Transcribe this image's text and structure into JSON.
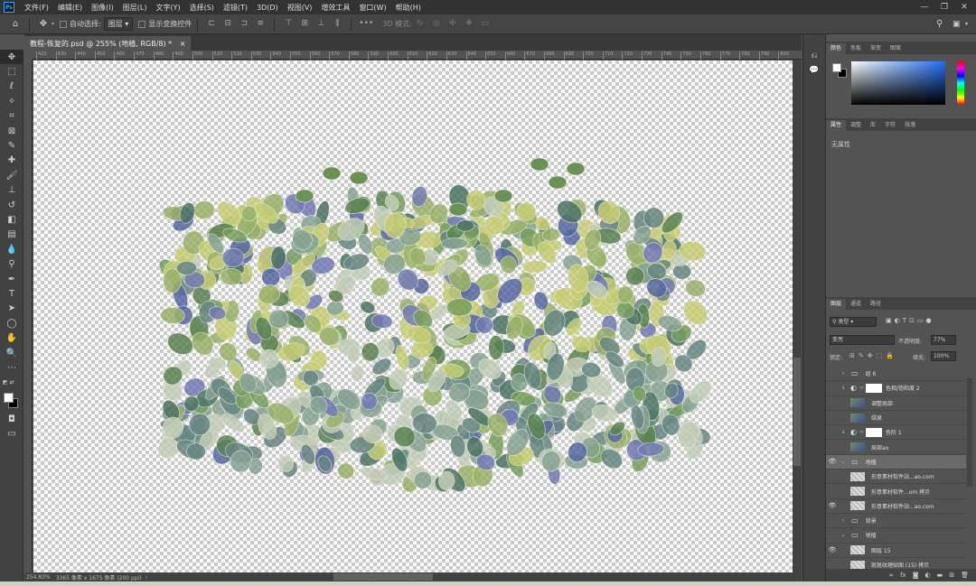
{
  "menubar": {
    "items": [
      "文件(F)",
      "编辑(E)",
      "图像(I)",
      "图层(L)",
      "文字(Y)",
      "选择(S)",
      "滤镜(T)",
      "3D(D)",
      "视图(V)",
      "增效工具",
      "窗口(W)",
      "帮助(H)"
    ]
  },
  "options": {
    "auto_select_label": "自动选择:",
    "layer_select_value": "图层",
    "show_transform_label": "显示变换控件",
    "mode_3d_label": "3D 模式:"
  },
  "document": {
    "tab_title": "教程-恢复的.psd @ 255% (地植, RGB/8) *",
    "ruler_ticks": [
      "420",
      "430",
      "440",
      "450",
      "460",
      "470",
      "480",
      "490",
      "500",
      "510",
      "520",
      "530",
      "540",
      "550",
      "560",
      "570",
      "580",
      "590",
      "600",
      "610",
      "620",
      "630",
      "640",
      "650",
      "660",
      "670",
      "680",
      "690",
      "700",
      "710",
      "720",
      "730",
      "740",
      "750",
      "760",
      "770",
      "780",
      "790",
      "800"
    ]
  },
  "status": {
    "zoom": "254.83%",
    "size_info": "3365 像素 x 1675 像素 (200 ppi)"
  },
  "color_panel": {
    "tabs": [
      "颜色",
      "色板",
      "渐变",
      "图案"
    ]
  },
  "properties_panel": {
    "tabs": [
      "属性",
      "调整",
      "库",
      "字符",
      "段落"
    ],
    "empty_text": "无属性"
  },
  "layers_panel": {
    "tabs": [
      "图层",
      "通道",
      "路径"
    ],
    "filter_kind": "类型",
    "blend_mode": "变亮",
    "opacity_label": "不透明度:",
    "opacity_value": "77%",
    "lock_label": "锁定:",
    "fill_label": "填充:",
    "fill_value": "100%",
    "layers": [
      {
        "name": "组 6",
        "type": "group",
        "visible": false
      },
      {
        "name": "色相/饱和度 2",
        "type": "adjustment",
        "visible": false
      },
      {
        "name": "调整局部",
        "type": "pixel",
        "visible": false
      },
      {
        "name": "绿泉",
        "type": "pixel",
        "visible": false
      },
      {
        "name": "色阶 1",
        "type": "adjustment",
        "visible": false
      },
      {
        "name": "局部ao",
        "type": "pixel",
        "visible": false
      },
      {
        "name": "地植",
        "type": "group-open",
        "visible": true
      },
      {
        "name": "形意素材软件站...ao.com",
        "type": "pixel",
        "visible": false
      },
      {
        "name": "形意素材软件...om 拷贝",
        "type": "pixel",
        "visible": false
      },
      {
        "name": "形意素材软件站...ao.com",
        "type": "pixel",
        "visible": true
      },
      {
        "name": "背景",
        "type": "group",
        "visible": false
      },
      {
        "name": "地植",
        "type": "group-open",
        "visible": false
      },
      {
        "name": "图层 15",
        "type": "pixel",
        "visible": true
      },
      {
        "name": "斑斑纹理贴图 (15) 拷贝",
        "type": "pixel",
        "visible": false
      }
    ]
  },
  "colors": {
    "menubar_bg": "#323232",
    "panel_bg": "#535353",
    "accent": "#31a8ff"
  }
}
